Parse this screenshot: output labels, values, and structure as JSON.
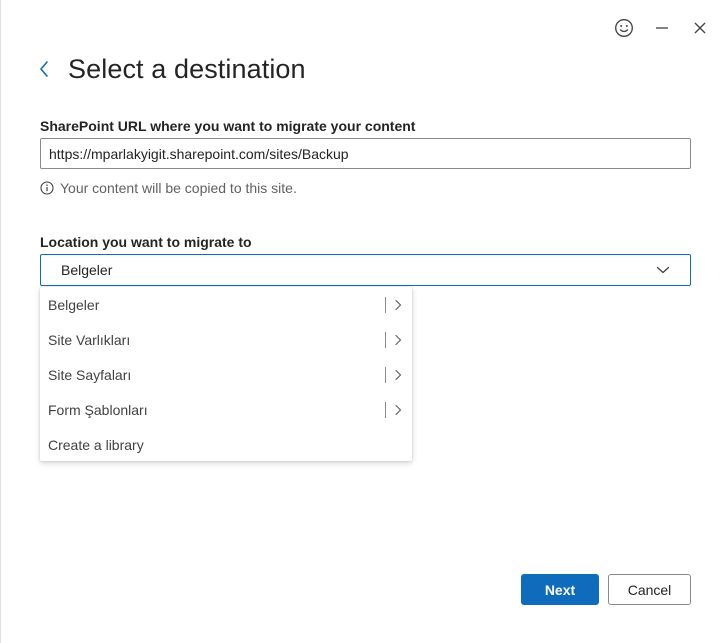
{
  "window": {
    "feedback_icon": "smiley-icon",
    "minimize_icon": "minimize-icon",
    "close_icon": "close-icon"
  },
  "header": {
    "back_icon": "chevron-left-icon",
    "title": "Select a destination"
  },
  "url_section": {
    "label": "SharePoint URL where you want to migrate your content",
    "value": "https://mparlakyigit.sharepoint.com/sites/Backup",
    "hint": "Your content will be copied to this site.",
    "hint_icon": "info-icon"
  },
  "location_section": {
    "label": "Location you want to migrate to",
    "selected": "Belgeler",
    "options": [
      {
        "label": "Belgeler",
        "has_children": true
      },
      {
        "label": "Site Varlıkları",
        "has_children": true
      },
      {
        "label": "Site Sayfaları",
        "has_children": true
      },
      {
        "label": "Form Şablonları",
        "has_children": true
      },
      {
        "label": "Create a library",
        "has_children": false
      }
    ]
  },
  "actions": {
    "next_label": "Next",
    "cancel_label": "Cancel"
  },
  "colors": {
    "accent": "#0f6cbd",
    "text": "#242424",
    "muted": "#616161"
  }
}
